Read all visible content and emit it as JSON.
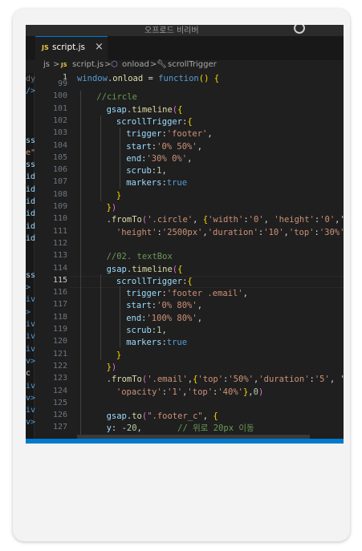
{
  "window": {
    "search_text": "오프로드 비리버"
  },
  "tab": {
    "badge": "JS",
    "name": "script.js",
    "close": "×"
  },
  "breadcrumb": {
    "folder": "js",
    "sep": ">",
    "badge": "JS",
    "file": "script.js",
    "func": "onload",
    "symbol": "scrollTrigger"
  },
  "sidebar_fragments": [
    {
      "t": "dy",
      "c": "#6e7681"
    },
    {
      "t": "/>",
      "c": "#569cd6"
    },
    {
      "t": "",
      "c": "#d4d4d4"
    },
    {
      "t": "",
      "c": "#d4d4d4"
    },
    {
      "t": "",
      "c": "#d4d4d4"
    },
    {
      "t": "ss",
      "c": "#9cdcfe"
    },
    {
      "t": "e\"",
      "c": "#ce9178"
    },
    {
      "t": "ss",
      "c": "#9cdcfe"
    },
    {
      "t": "id",
      "c": "#9cdcfe"
    },
    {
      "t": "id",
      "c": "#9cdcfe"
    },
    {
      "t": "id",
      "c": "#9cdcfe"
    },
    {
      "t": "id",
      "c": "#9cdcfe"
    },
    {
      "t": "id",
      "c": "#9cdcfe"
    },
    {
      "t": "id",
      "c": "#9cdcfe"
    },
    {
      "t": "",
      "c": "#d4d4d4"
    },
    {
      "t": "",
      "c": "#d4d4d4"
    },
    {
      "t": "ss",
      "c": "#9cdcfe"
    },
    {
      "t": ">",
      "c": "#569cd6"
    },
    {
      "t": "iv",
      "c": "#569cd6"
    },
    {
      "t": ">",
      "c": "#569cd6"
    },
    {
      "t": "iv",
      "c": "#569cd6"
    },
    {
      "t": "iv",
      "c": "#569cd6"
    },
    {
      "t": "iv",
      "c": "#569cd6"
    },
    {
      "t": "v>",
      "c": "#569cd6"
    },
    {
      "t": "c",
      "c": "#d4d4d4"
    },
    {
      "t": "iv",
      "c": "#569cd6"
    },
    {
      "t": "v>",
      "c": "#569cd6"
    },
    {
      "t": "iv",
      "c": "#569cd6"
    },
    {
      "t": "v>",
      "c": "#569cd6"
    },
    {
      "t": "",
      "c": "#d4d4d4"
    }
  ],
  "line_numbers": [
    "99",
    "100",
    "101",
    "102",
    "103",
    "104",
    "105",
    "106",
    "107",
    "108",
    "109",
    "110",
    "111",
    "112",
    "113",
    "114",
    "115",
    "116",
    "117",
    "118",
    "119",
    "120",
    "121",
    "122",
    "123",
    "124",
    "125",
    "126",
    "127"
  ],
  "active_line": "115",
  "sticky_line": {
    "number": "1",
    "text": "window.onload = function() {"
  },
  "code_lines": [
    "",
    "//circle",
    "gsap.timeline({",
    "scrollTrigger:{",
    "trigger:'footer',",
    "start:'0% 50%',",
    "end:'30% 0%',",
    "scrub:1,",
    "markers:true",
    "}",
    "})",
    ".fromTo('.circle', {'width':'0', 'height':'0','d",
    "'height':'2500px','duration':'10','top':'30%'}",
    "",
    "//02. textBox",
    "gsap.timeline({",
    "scrollTrigger:{",
    "trigger:'footer .email',",
    "start:'0% 80%',",
    "end:'100% 80%',",
    "scrub:1,",
    "markers:true",
    "}",
    "})",
    ".fromTo('.email',{'top':'50%','duration':'5', 'e",
    "'opacity':'1','top':'40%'},0)",
    "",
    "gsap.to(\".footer_c\", {",
    "y: -20,       // 위로 20px 이동"
  ]
}
